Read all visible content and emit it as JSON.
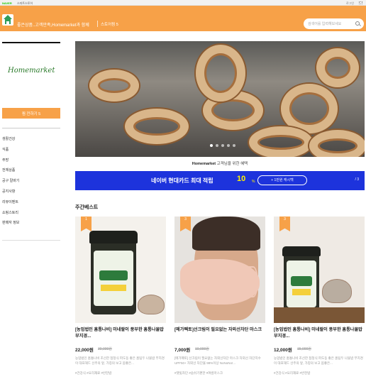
{
  "topbar": {
    "logo": "NAVER",
    "brand": "스마트스토어",
    "login": "로그인"
  },
  "header": {
    "store_name": "좋은상품..고객만족,Homemarket과 함께",
    "zzim": "스토어찜 5",
    "search_placeholder": "검색어를 입력해보세요"
  },
  "sidebar": {
    "logo": "Homemarket",
    "zzim_button": "찜 전하기 5",
    "menu": [
      "생활건강",
      "식품",
      "주방",
      "전체상품",
      "공구 칼바기",
      "공지사항",
      "리뷰이벤트",
      "쇼핑스토리",
      "판매자 정보"
    ]
  },
  "banner": {
    "caption_brand": "Homemarket",
    "caption_text": " 고객님을 위한 혜택",
    "slides": 5,
    "active_slide": 1
  },
  "ad": {
    "left_text": "네이버 현대카드",
    "mid_text": "최대 적립",
    "big": "10",
    "unit": "%",
    "pill": "+ 1만원 캐시백",
    "page": "/ 3"
  },
  "section_title": "주간베스트",
  "products": [
    {
      "rank": "1",
      "title": "[농업법인 홈통나비] 미네랄이 풍부한 홈통나물밥 부지경...",
      "price": "22,000원",
      "original": "30,000원",
      "desc": "농업법인 홈통나비 조선한 접청식 파도동 좋은 홈팀두 나물밥 부지경이 대표해드 선주의 앞, 가칭의 보고 몸좋은...",
      "tags": "#건강식 #요리재료 #반찬밥"
    },
    {
      "rank": "3",
      "title": "[메가펙토]선크림이 필요없는 자외선차단 마스크",
      "price": "7,000원",
      "original": "10,000원",
      "desc": "[메가펙토] 선크림이 필요없는 자외선차단 마스크 자외선 차단지수 UPF50+ 자외선 차단율 98%이상 NoNoNo!...",
      "tags": "#햇빛차단 #숨쉬기편한 #여름마스크"
    },
    {
      "rank": "3",
      "title": "[농업법인 홈통나비] 미네랄이 풍부한 홈통나물밥 부지경...",
      "price": "12,000원",
      "original": "15,000원",
      "desc": "농업법인 홈통나비 조선한 접청식 파도동 좋은 홈팀두 나물밥 부지경이 대표해드 선주의 앞, 가칭의 보고 몸좋은...",
      "tags": "#건강식 #요리재료 #반찬밥"
    }
  ],
  "colors": {
    "brand_orange": "#f7a148",
    "ad_blue": "#1d33dc",
    "ad_yellow": "#fff200"
  }
}
